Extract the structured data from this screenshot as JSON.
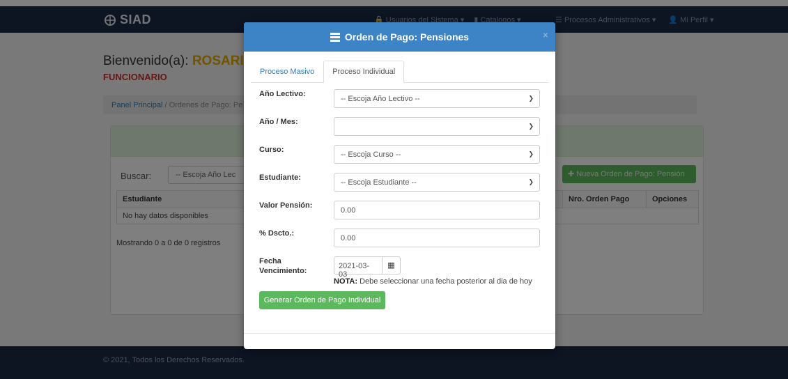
{
  "brand": {
    "name": "SIAD",
    "logo_icon": "globe-logo-icon"
  },
  "topnav": {
    "items": [
      {
        "label": "Usuarios del Sistema",
        "icon": "lock-icon"
      },
      {
        "label": "Catalogos",
        "icon": "file-icon"
      },
      {
        "label": "Procesos Administrativos",
        "icon": "list-icon"
      },
      {
        "label": "Mi Perfil",
        "icon": "user-icon"
      }
    ]
  },
  "welcome": {
    "prefix": "Bienvenido(a):",
    "name": "ROSARIO",
    "role": "FUNCIONARIO"
  },
  "breadcrumb": {
    "home": "Panel Principal",
    "separator": "/",
    "current": "Ordenes de Pago: Pe"
  },
  "list": {
    "search_label": "Buscar:",
    "search_select": "-- Escoja Año Lec",
    "new_button": "Nueva Orden de Pago: Pensión",
    "columns": [
      "Estudiante",
      "Nro. Orden Pago",
      "Opciones"
    ],
    "empty": "No hay datos disponibles",
    "showing": "Mostrando 0 a 0 de 0 registros"
  },
  "footer": {
    "copyright": "© 2021, Todos los Derechos Reservados."
  },
  "modal": {
    "title": "Orden de Pago: Pensiones",
    "close": "×",
    "tabs": [
      {
        "label": "Proceso Masivo",
        "active": false
      },
      {
        "label": "Proceso Individual",
        "active": true
      }
    ],
    "fields": {
      "anio_lectivo": {
        "label": "Año Lectivo:",
        "value": "-- Escoja Año Lectivo --"
      },
      "anio_mes": {
        "label": "Año / Mes:",
        "value": ""
      },
      "curso": {
        "label": "Curso:",
        "value": "-- Escoja Curso --"
      },
      "estudiante": {
        "label": "Estudiante:",
        "value": "-- Escoja Estudiante --"
      },
      "valor_pension": {
        "label": "Valor Pensión:",
        "value": "0.00"
      },
      "descuento": {
        "label": "% Dscto.:",
        "value": "0.00"
      },
      "fecha_vencimiento": {
        "label": "Fecha Vencimiento:",
        "value": "2021-03-03",
        "nota_bold": "NOTA:",
        "nota": "Debe seleccionar una fecha posterior al dia de hoy"
      }
    },
    "submit": "Generar Orden de Pago Individual"
  },
  "colors": {
    "navbar": "#1b2945",
    "modal_header": "#3c84c6",
    "success": "#5cb85c",
    "role": "#c9302c"
  }
}
